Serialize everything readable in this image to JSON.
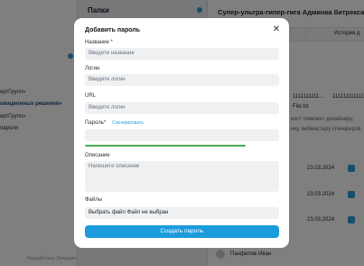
{
  "background": {
    "folders_title": "Папки",
    "sidebar_lines": [
      "ертГрупп»",
      "овационных решения»",
      "ертГрупп»",
      "пароли"
    ],
    "sidebar_footer": "Разработано: Zoraa.pro",
    "main_title": "Супер-ультра-гипер-гига Админка битрекса",
    "history_col": "История д",
    "row_values": [
      "1111111111...",
      "1111111111111111111",
      "File.txt"
    ],
    "desc_lines": [
      "екст поможет дизайнеру,",
      "ику, вебмастеру сгенериров"
    ],
    "dates": [
      "23.03.2024",
      "23.03.2024",
      "23.03.2024"
    ],
    "user_name": "Панфилов Иван"
  },
  "modal": {
    "title": "Добавить пароль",
    "fields": {
      "name_label": "Название *",
      "name_placeholder": "Введите название",
      "login_label": "Логин",
      "login_placeholder": "Введите логин",
      "url_label": "URL",
      "url_placeholder": "Введите логин",
      "password_label": "Пароль*",
      "generate_link": "Сгенерировать",
      "password_strength": 0.83,
      "description_label": "Описание",
      "description_placeholder": "Напишите описание",
      "files_label": "Файлы",
      "file_button": "Выбрать файл",
      "file_status": "Файл не выбран"
    },
    "submit_label": "Создать пароль",
    "colors": {
      "accent": "#1a9bdc",
      "strength": "#4cae4f"
    }
  }
}
